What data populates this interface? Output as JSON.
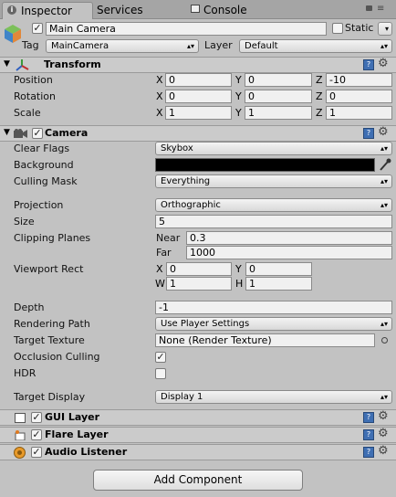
{
  "tabs": [
    {
      "label": "Inspector",
      "icon": "info-icon"
    },
    {
      "label": "Services"
    },
    {
      "label": "Console",
      "icon": "console-icon"
    }
  ],
  "object": {
    "name": "Main Camera",
    "active": true,
    "static_label": "Static",
    "tag_label": "Tag",
    "tag_value": "MainCamera",
    "layer_label": "Layer",
    "layer_value": "Default"
  },
  "transform": {
    "title": "Transform",
    "position_label": "Position",
    "rotation_label": "Rotation",
    "scale_label": "Scale",
    "axes": [
      "X",
      "Y",
      "Z"
    ],
    "position": [
      "0",
      "0",
      "-10"
    ],
    "rotation": [
      "0",
      "0",
      "0"
    ],
    "scale": [
      "1",
      "1",
      "1"
    ]
  },
  "camera": {
    "title": "Camera",
    "enabled": true,
    "clear_flags_label": "Clear Flags",
    "clear_flags": "Skybox",
    "background_label": "Background",
    "background_color": "#000000",
    "culling_mask_label": "Culling Mask",
    "culling_mask": "Everything",
    "projection_label": "Projection",
    "projection": "Orthographic",
    "size_label": "Size",
    "size": "5",
    "clipping_label": "Clipping Planes",
    "near_label": "Near",
    "near": "0.3",
    "far_label": "Far",
    "far": "1000",
    "viewport_label": "Viewport Rect",
    "viewport": {
      "x_label": "X",
      "x": "0",
      "y_label": "Y",
      "y": "0",
      "w_label": "W",
      "w": "1",
      "h_label": "H",
      "h": "1"
    },
    "depth_label": "Depth",
    "depth": "-1",
    "rendering_path_label": "Rendering Path",
    "rendering_path": "Use Player Settings",
    "target_texture_label": "Target Texture",
    "target_texture": "None (Render Texture)",
    "occlusion_label": "Occlusion Culling",
    "occlusion": true,
    "hdr_label": "HDR",
    "hdr": false,
    "target_display_label": "Target Display",
    "target_display": "Display 1"
  },
  "components": [
    {
      "title": "GUI Layer",
      "enabled": true
    },
    {
      "title": "Flare Layer",
      "enabled": true
    },
    {
      "title": "Audio Listener",
      "enabled": true
    }
  ],
  "add_component_label": "Add Component"
}
